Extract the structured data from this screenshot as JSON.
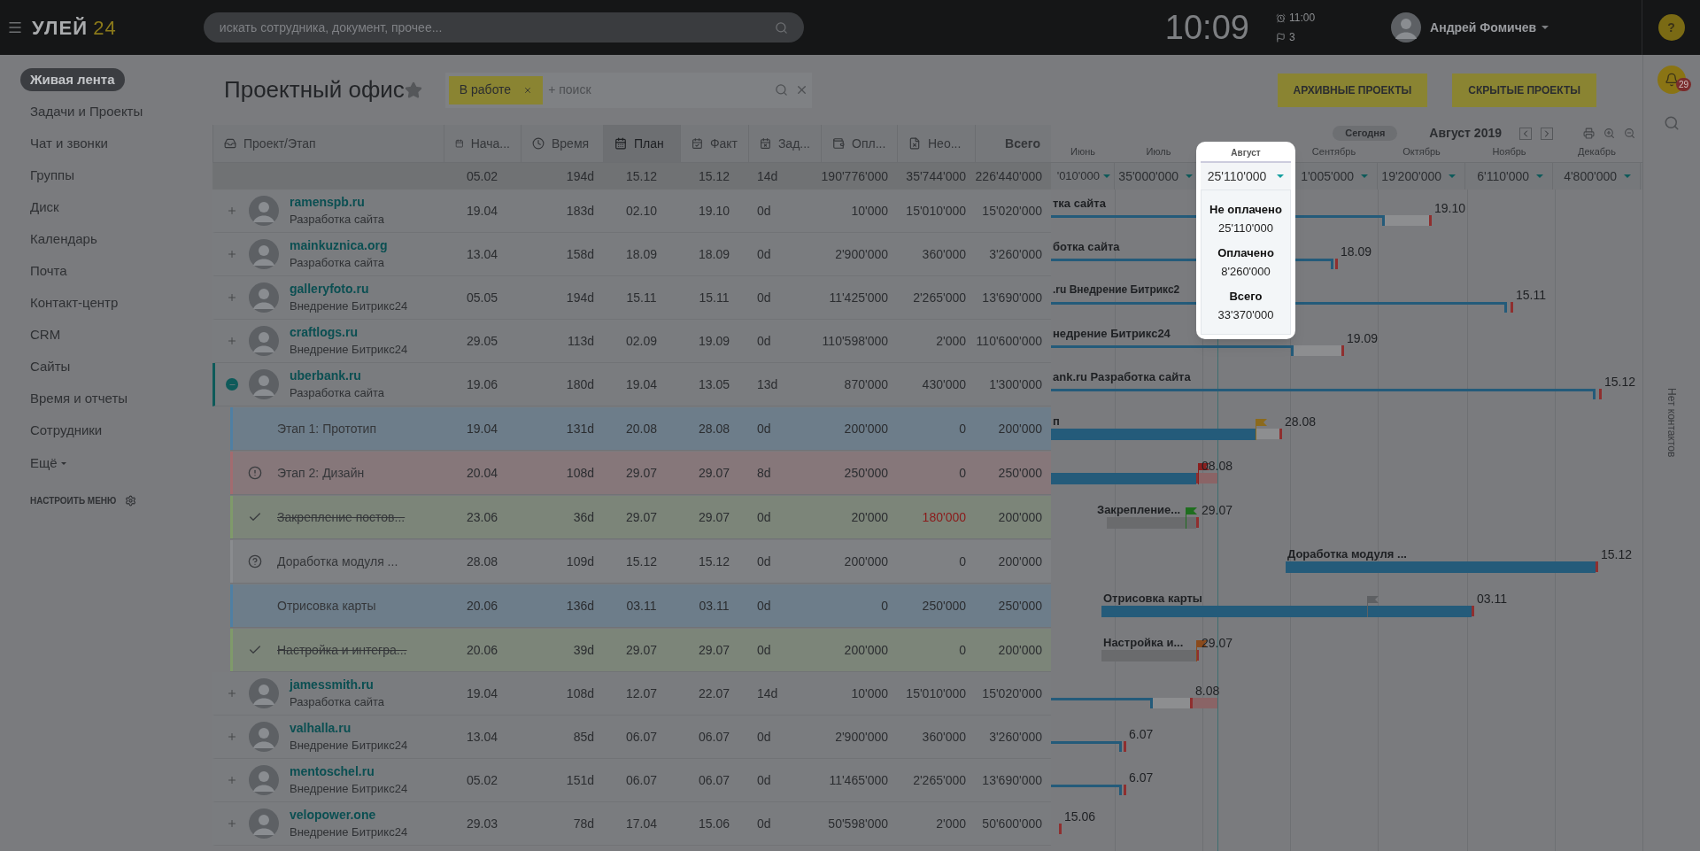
{
  "topbar": {
    "logo": "УЛЕЙ",
    "logo_number": "24",
    "search_placeholder": "искать сотрудника, документ, прочее...",
    "clock": "10:09",
    "alarm": "11:00",
    "flags": "3",
    "user": "Андрей Фомичев",
    "help": "?"
  },
  "sidebar": {
    "items": [
      {
        "label": "Живая лента",
        "selected": true
      },
      {
        "label": "Задачи и Проекты",
        "selected": false
      },
      {
        "label": "Чат и звонки",
        "selected": false
      },
      {
        "label": "Группы",
        "selected": false
      },
      {
        "label": "Диск",
        "selected": false
      },
      {
        "label": "Календарь",
        "selected": false
      },
      {
        "label": "Почта",
        "selected": false
      },
      {
        "label": "Контакт-центр",
        "selected": false
      },
      {
        "label": "CRM",
        "selected": false
      },
      {
        "label": "Сайты",
        "selected": false
      },
      {
        "label": "Время и отчеты",
        "selected": false
      },
      {
        "label": "Сотрудники",
        "selected": false
      }
    ],
    "more": "Ещё",
    "configure": "НАСТРОИТЬ МЕНЮ"
  },
  "page": {
    "title": "Проектный офис",
    "filter_tag": "В работе",
    "search_placeholder": "+ поиск",
    "buttons": [
      "АРХИВНЫЕ ПРОЕКТЫ",
      "СКРЫТЫЕ ПРОЕКТЫ"
    ]
  },
  "right_panel": {
    "notifications": "29",
    "contacts": "Нет контактов"
  },
  "table": {
    "columns": [
      {
        "label": "Проект/Этап",
        "selected": false
      },
      {
        "label": "Нача...",
        "selected": false
      },
      {
        "label": "Время",
        "selected": false
      },
      {
        "label": "План",
        "selected": true
      },
      {
        "label": "Факт",
        "selected": false
      },
      {
        "label": "Зад...",
        "selected": false
      },
      {
        "label": "Опл...",
        "selected": false
      },
      {
        "label": "Нео...",
        "selected": false
      },
      {
        "label": "Всего",
        "selected": false
      }
    ],
    "totals": [
      "05.02",
      "194d",
      "15.12",
      "15.12",
      "14d",
      "190'776'000",
      "35'744'000",
      "226'440'000"
    ],
    "rows": [
      {
        "kind": "project",
        "expanded": false,
        "name": "ramenspb.ru",
        "subtitle": "Разработка сайта",
        "values": [
          "19.04",
          "183d",
          "02.10",
          "19.10",
          "0d",
          "10'000",
          "15'010'000",
          "15'020'000"
        ]
      },
      {
        "kind": "project",
        "expanded": false,
        "name": "mainkuznica.org",
        "subtitle": "Разработка сайта",
        "values": [
          "13.04",
          "158d",
          "18.09",
          "18.09",
          "0d",
          "2'900'000",
          "360'000",
          "3'260'000"
        ]
      },
      {
        "kind": "project",
        "expanded": false,
        "name": "galleryfoto.ru",
        "subtitle": "Внедрение Битрикс24",
        "values": [
          "05.05",
          "194d",
          "15.11",
          "15.11",
          "0d",
          "11'425'000",
          "2'265'000",
          "13'690'000"
        ]
      },
      {
        "kind": "project",
        "expanded": false,
        "name": "craftlogs.ru",
        "subtitle": "Внедрение Битрикс24",
        "values": [
          "29.05",
          "113d",
          "02.09",
          "19.09",
          "0d",
          "110'598'000",
          "2'000",
          "110'600'000"
        ]
      },
      {
        "kind": "project",
        "expanded": true,
        "name": "uberbank.ru",
        "subtitle": "Разработка сайта",
        "values": [
          "19.06",
          "180d",
          "19.04",
          "13.05",
          "13d",
          "870'000",
          "430'000",
          "1'300'000"
        ]
      },
      {
        "kind": "stage",
        "done": false,
        "overdue": false,
        "unclear": false,
        "color": "#4f7fa3",
        "name": "Этап 1: Прототип",
        "unpaid_alert": false,
        "values": [
          "19.04",
          "131d",
          "20.08",
          "28.08",
          "0d",
          "200'000",
          "0",
          "200'000"
        ]
      },
      {
        "kind": "stage",
        "done": false,
        "overdue": true,
        "unclear": false,
        "color": "#a36b6f",
        "name": "Этап 2: Дизайн",
        "unpaid_alert": false,
        "values": [
          "20.04",
          "108d",
          "29.07",
          "29.07",
          "8d",
          "250'000",
          "0",
          "250'000"
        ]
      },
      {
        "kind": "stage",
        "done": true,
        "overdue": false,
        "unclear": false,
        "color": "#7f9a6a",
        "name": "Закрепление постов...",
        "unpaid_alert": true,
        "values": [
          "23.06",
          "36d",
          "29.07",
          "29.07",
          "0d",
          "20'000",
          "180'000",
          "200'000"
        ]
      },
      {
        "kind": "stage",
        "done": false,
        "overdue": false,
        "unclear": true,
        "color": "#8a8c8f",
        "name": "Доработка модуля ...",
        "unpaid_alert": false,
        "values": [
          "28.08",
          "109d",
          "15.12",
          "15.12",
          "0d",
          "200'000",
          "0",
          "200'000"
        ]
      },
      {
        "kind": "stage",
        "done": false,
        "overdue": false,
        "unclear": false,
        "color": "#4f7fa3",
        "name": "Отрисовка карты",
        "unpaid_alert": false,
        "values": [
          "20.06",
          "136d",
          "03.11",
          "03.11",
          "0d",
          "0",
          "250'000",
          "250'000"
        ]
      },
      {
        "kind": "stage",
        "done": true,
        "overdue": false,
        "unclear": false,
        "color": "#7f9a6a",
        "name": "Настройка и интегра...",
        "unpaid_alert": false,
        "values": [
          "20.06",
          "39d",
          "29.07",
          "29.07",
          "0d",
          "200'000",
          "0",
          "200'000"
        ]
      },
      {
        "kind": "project",
        "expanded": false,
        "name": "jamessmith.ru",
        "subtitle": "Разработка сайта",
        "values": [
          "19.04",
          "108d",
          "12.07",
          "22.07",
          "14d",
          "10'000",
          "15'010'000",
          "15'020'000"
        ]
      },
      {
        "kind": "project",
        "expanded": false,
        "name": "valhalla.ru",
        "subtitle": "Внедрение Битрикс24",
        "values": [
          "13.04",
          "85d",
          "06.07",
          "06.07",
          "0d",
          "2'900'000",
          "360'000",
          "3'260'000"
        ]
      },
      {
        "kind": "project",
        "expanded": false,
        "name": "mentoschel.ru",
        "subtitle": "Внедрение Битрикс24",
        "values": [
          "05.02",
          "151d",
          "06.07",
          "06.07",
          "0d",
          "11'465'000",
          "2'265'000",
          "13'690'000"
        ]
      },
      {
        "kind": "project",
        "expanded": false,
        "name": "velopower.one",
        "subtitle": "Внедрение Битрикс24",
        "values": [
          "29.03",
          "78d",
          "17.04",
          "15.06",
          "0d",
          "50'598'000",
          "2'000",
          "50'600'000"
        ]
      }
    ]
  },
  "gantt": {
    "today": "Сегодня",
    "period": "Август 2019",
    "months": [
      {
        "name": "Июнь",
        "total": "'010'000",
        "selected": false
      },
      {
        "name": "Июль",
        "total": "35'000'000",
        "selected": false
      },
      {
        "name": "Август",
        "total": "25'110'000",
        "selected": true
      },
      {
        "name": "Сентябрь",
        "total": "1'005'000",
        "selected": false
      },
      {
        "name": "Октябрь",
        "total": "19'200'000",
        "selected": false
      },
      {
        "name": "Ноябрь",
        "total": "6'110'000",
        "selected": false
      },
      {
        "name": "Декабрь",
        "total": "4'800'000",
        "selected": false
      }
    ],
    "popup": {
      "entries": [
        {
          "label": "Не оплачено",
          "value": "25'110'000"
        },
        {
          "label": "Оплачено",
          "value": "8'260'000"
        },
        {
          "label": "Всего",
          "value": "33'370'000"
        }
      ]
    },
    "rows": [
      {
        "label": "тка сайта",
        "date": "19.10"
      },
      {
        "label": "ботка сайта",
        "date": "18.09"
      },
      {
        "label": ".ru Внедрение Битрикс2",
        "date": "15.11"
      },
      {
        "label": "недрение Битрикс24",
        "date": "19.09"
      },
      {
        "label": "ank.ru Разработка сайта",
        "date": "15.12"
      },
      {
        "label": "п",
        "date": "28.08",
        "color": "#8c6a1c"
      },
      {
        "date": "08.08",
        "color": "#8a1f1f"
      },
      {
        "label": "Закрепление...",
        "date": "29.07",
        "color": "#1f6e1f"
      },
      {
        "label": "Доработка модуля ...",
        "date": "15.12"
      },
      {
        "label": "Отрисовка карты",
        "date": "03.11",
        "color": "#5e6063"
      },
      {
        "label": "Настройка и...",
        "date": "29.07",
        "color": "#8a4a1c"
      },
      {
        "date": "8.08"
      },
      {
        "date": "6.07"
      },
      {
        "date": "6.07"
      },
      {
        "date": "15.06"
      }
    ]
  }
}
